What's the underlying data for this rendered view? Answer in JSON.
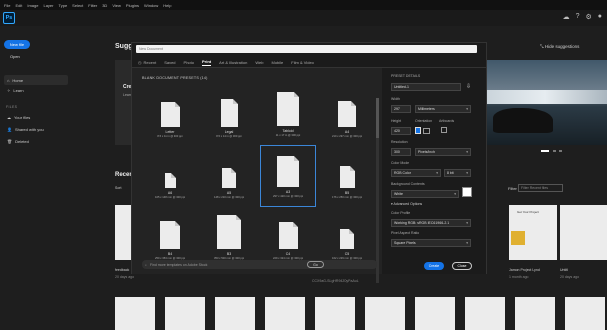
{
  "menu": [
    "File",
    "Edit",
    "Image",
    "Layer",
    "Type",
    "Select",
    "Filter",
    "3D",
    "View",
    "Plugins",
    "Window",
    "Help"
  ],
  "app_logo": "Ps",
  "sidebar": {
    "new_file": "New file",
    "open": "Open",
    "home": "Home",
    "learn": "Learn",
    "files_heading": "FILES",
    "your_files": "Your files",
    "shared_with_you": "Shared with you",
    "deleted": "Deleted"
  },
  "main": {
    "suggestions_title": "Sugges",
    "hide_suggestions": "Hide suggestions",
    "hero_partial_title": "Crea",
    "hero_partial_sub": "Learn",
    "recent_title": "Recent",
    "sort_label": "Sort",
    "filter_label": "Filter",
    "filter_placeholder": "Filter Recent files",
    "recent_items": [
      {
        "name": "feedback",
        "meta": "20 days ago"
      },
      {
        "name": "Jamon Project Lynd",
        "meta": "1 month ago"
      },
      {
        "name": "Untitl",
        "meta": "20 days ago"
      },
      {
        "name": "CCX9aG-SLgHR94Z0yPaAuL",
        "meta": "26 days ago"
      }
    ]
  },
  "dialog": {
    "search_placeholder": "New Document",
    "tabs": [
      "Recent",
      "Saved",
      "Photo",
      "Print",
      "Art & Illustration",
      "Web",
      "Mobile",
      "Film & Video"
    ],
    "active_tab": "Print",
    "presets_heading": "BLANK DOCUMENT PRESETS",
    "presets_count": "(14)",
    "presets": [
      {
        "name": "Letter",
        "dim": "8.5 x 11 in @ 300 ppi"
      },
      {
        "name": "Legal",
        "dim": "8.5 x 14 in @ 300 ppi"
      },
      {
        "name": "Tabloid",
        "dim": "11 x 17 in @ 300 ppi"
      },
      {
        "name": "A4",
        "dim": "210 x 297 mm @ 300 ppi"
      },
      {
        "name": "A6",
        "dim": "105 x 148 mm @ 300 ppi"
      },
      {
        "name": "A5",
        "dim": "148 x 210 mm @ 300 ppi"
      },
      {
        "name": "A3",
        "dim": "297 x 420 mm @ 300 ppi"
      },
      {
        "name": "B5",
        "dim": "176 x 250 mm @ 300 ppi"
      },
      {
        "name": "B4",
        "dim": "250 x 353 mm @ 300 ppi"
      },
      {
        "name": "B3",
        "dim": "353 x 500 mm @ 300 ppi"
      },
      {
        "name": "C4",
        "dim": "229 x 324 mm @ 300 ppi"
      },
      {
        "name": "C5",
        "dim": "162 x 229 mm @ 300 ppi"
      }
    ],
    "selected_preset": "A3",
    "find_more_placeholder": "Find more templates on Adobe Stock",
    "go_label": "Go",
    "details": {
      "heading": "PRESET DETAILS",
      "name": "Untitled-1",
      "width_label": "Width",
      "width_value": "297",
      "width_unit": "Millimeters",
      "height_label": "Height",
      "height_value": "420",
      "orientation_label": "Orientation",
      "artboards_label": "Artboards",
      "resolution_label": "Resolution",
      "resolution_value": "300",
      "resolution_unit": "Pixels/Inch",
      "color_mode_label": "Color Mode",
      "color_mode_value": "RGB Color",
      "bit_depth": "8 bit",
      "bg_label": "Background Contents",
      "bg_value": "White",
      "advanced_label": "Advanced Options",
      "profile_label": "Color Profile",
      "profile_value": "Working RGB: sRGB IEC61966-2.1",
      "pixel_ratio_label": "Pixel Aspect Ratio",
      "pixel_ratio_value": "Square Pixels"
    },
    "create_label": "Create",
    "close_label": "Close"
  },
  "colors": {
    "accent": "#1473e6",
    "selected_border": "#3b86d8",
    "ps_blue": "#31a8ff"
  }
}
